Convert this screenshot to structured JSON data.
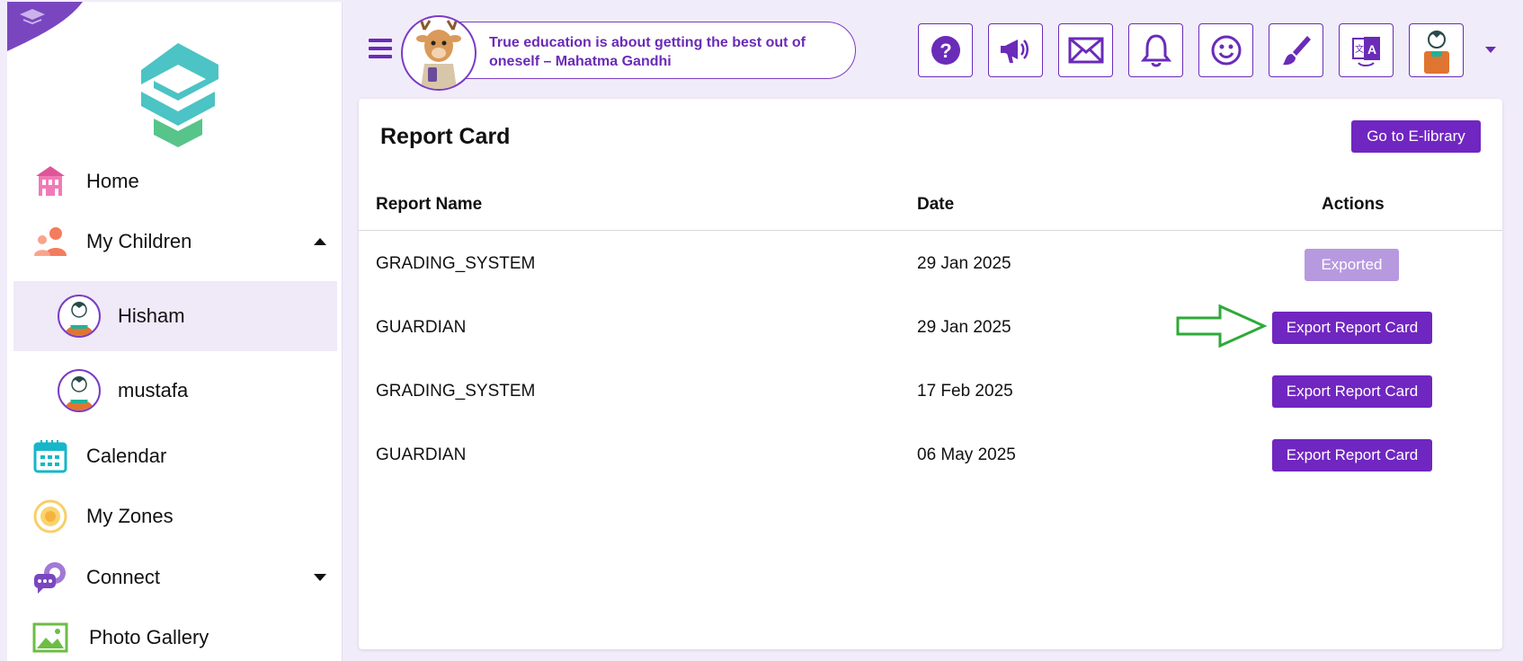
{
  "sidebar": {
    "nav": {
      "home": "Home",
      "my_children": "My Children",
      "calendar": "Calendar",
      "my_zones": "My Zones",
      "connect": "Connect",
      "photo_gallery": "Photo Gallery"
    },
    "children": [
      "Hisham",
      "mustafa"
    ],
    "active_child": "Hisham"
  },
  "header": {
    "quote": "True education is about getting the best out of oneself – Mahatma Gandhi",
    "icons": [
      "help-icon",
      "megaphone-icon",
      "mail-icon",
      "bell-icon",
      "smiley-icon",
      "paintbrush-icon",
      "translate-icon",
      "profile-avatar-icon"
    ]
  },
  "report_card": {
    "title": "Report Card",
    "library_button": "Go to E-library",
    "columns": {
      "name": "Report Name",
      "date": "Date",
      "actions": "Actions"
    },
    "rows": [
      {
        "name": "GRADING_SYSTEM",
        "date": "29 Jan 2025",
        "action": "Exported"
      },
      {
        "name": "GUARDIAN",
        "date": "29 Jan 2025",
        "action": "Export Report Card"
      },
      {
        "name": "GRADING_SYSTEM",
        "date": "17 Feb 2025",
        "action": "Export Report Card"
      },
      {
        "name": "GUARDIAN",
        "date": "06 May 2025",
        "action": "Export Report Card"
      }
    ]
  },
  "colors": {
    "accent": "#7026c0",
    "accent_light": "#b799df",
    "background": "#f1ecf9",
    "annotation_arrow": "#2eaa3a"
  }
}
